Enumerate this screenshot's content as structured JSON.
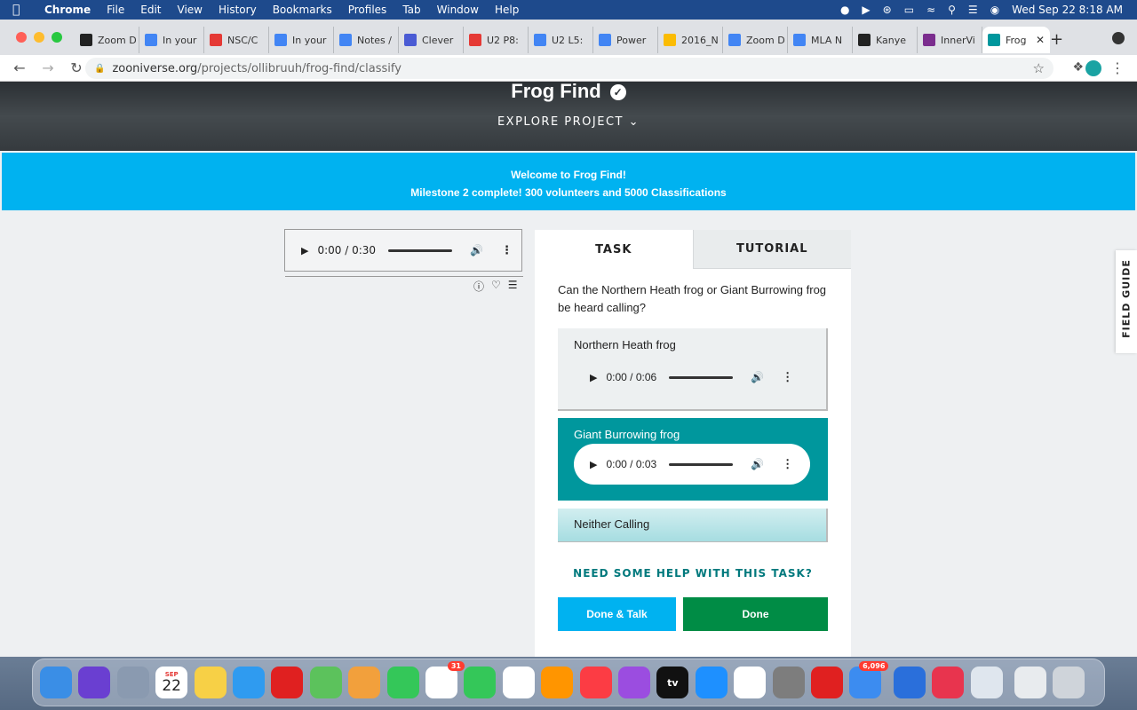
{
  "menubar": {
    "app": "Chrome",
    "items": [
      "File",
      "Edit",
      "View",
      "History",
      "Bookmarks",
      "Profiles",
      "Tab",
      "Window",
      "Help"
    ],
    "datetime": "Wed Sep 22  8:18 AM"
  },
  "tabs": [
    {
      "label": "Zoom D",
      "icon": "zoom-icon",
      "color": "#222222"
    },
    {
      "label": "In your",
      "icon": "google-docs-icon",
      "color": "#4285f4"
    },
    {
      "label": "NSC/C",
      "icon": "ring-icon",
      "color": "#e53935"
    },
    {
      "label": "In your",
      "icon": "google-docs-icon",
      "color": "#4285f4"
    },
    {
      "label": "Notes /",
      "icon": "google-docs-icon",
      "color": "#4285f4"
    },
    {
      "label": "Clever",
      "icon": "clever-icon",
      "color": "#4a5bd4"
    },
    {
      "label": "U2 P8:",
      "icon": "ring-icon",
      "color": "#e53935"
    },
    {
      "label": "U2 L5:",
      "icon": "google-docs-icon",
      "color": "#4285f4"
    },
    {
      "label": "Power",
      "icon": "google-docs-icon",
      "color": "#4285f4"
    },
    {
      "label": "2016_N",
      "icon": "google-drive-icon",
      "color": "#fbbc04"
    },
    {
      "label": "Zoom D",
      "icon": "google-docs-icon",
      "color": "#4285f4"
    },
    {
      "label": "MLA N",
      "icon": "google-docs-icon",
      "color": "#4285f4"
    },
    {
      "label": "Kanye",
      "icon": "nyt-icon",
      "color": "#222222"
    },
    {
      "label": "InnerVi",
      "icon": "innervision-icon",
      "color": "#7b2d8e"
    },
    {
      "label": "Frog",
      "icon": "zooniverse-icon",
      "color": "#00979d",
      "active": true
    }
  ],
  "address": {
    "domain": "zooniverse.org",
    "path": "/projects/ollibruuh/frog-find/classify"
  },
  "hero": {
    "title": "Frog Find",
    "explore": "EXPLORE PROJECT"
  },
  "banner": {
    "line1": "Welcome to Frog Find!",
    "line2": "Milestone 2 complete! 300 volunteers and 5000 Classifications"
  },
  "subject_audio": {
    "time": "0:00 / 0:30"
  },
  "panel": {
    "tab_task": "TASK",
    "tab_tutorial": "TUTORIAL",
    "question": "Can the Northern Heath frog or Giant Burrowing frog be heard calling?",
    "options": [
      {
        "label": "Northern Heath frog",
        "audio_time": "0:00 / 0:06"
      },
      {
        "label": "Giant Burrowing frog",
        "audio_time": "0:00 / 0:03"
      },
      {
        "label": "Neither Calling"
      }
    ],
    "help": "NEED SOME HELP WITH THIS TASK?",
    "done_talk": "Done & Talk",
    "done": "Done"
  },
  "field_guide": "FIELD GUIDE",
  "dock": {
    "calendar_month": "SEP",
    "calendar_day": "22",
    "reminders_badge": "31",
    "mail_badge": "6,096",
    "tv_label": "tv"
  }
}
